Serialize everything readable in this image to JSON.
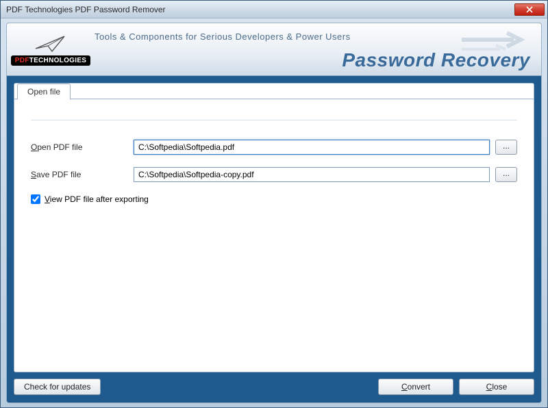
{
  "window": {
    "title": "PDF Technologies PDF Password Remover"
  },
  "banner": {
    "logo_prefix": "PDF",
    "logo_suffix": "TECHNOLOGIES",
    "tagline": "Tools & Components for Serious Developers & Power Users",
    "title": "Password Recovery"
  },
  "tab": {
    "label": "Open file"
  },
  "form": {
    "open_label_pre": "O",
    "open_label_rest": "pen PDF file",
    "open_value": "C:\\Softpedia\\Softpedia.pdf",
    "save_label_pre": "S",
    "save_label_rest": "ave PDF file",
    "save_value": "C:\\Softpedia\\Softpedia-copy.pdf",
    "browse_label": "...",
    "view_label_pre": "V",
    "view_label_rest": "iew PDF file after exporting",
    "view_checked": true
  },
  "footer": {
    "updates": "Check for updates",
    "convert_pre": "C",
    "convert_rest": "onvert",
    "close_pre": "C",
    "close_rest": "lose"
  }
}
